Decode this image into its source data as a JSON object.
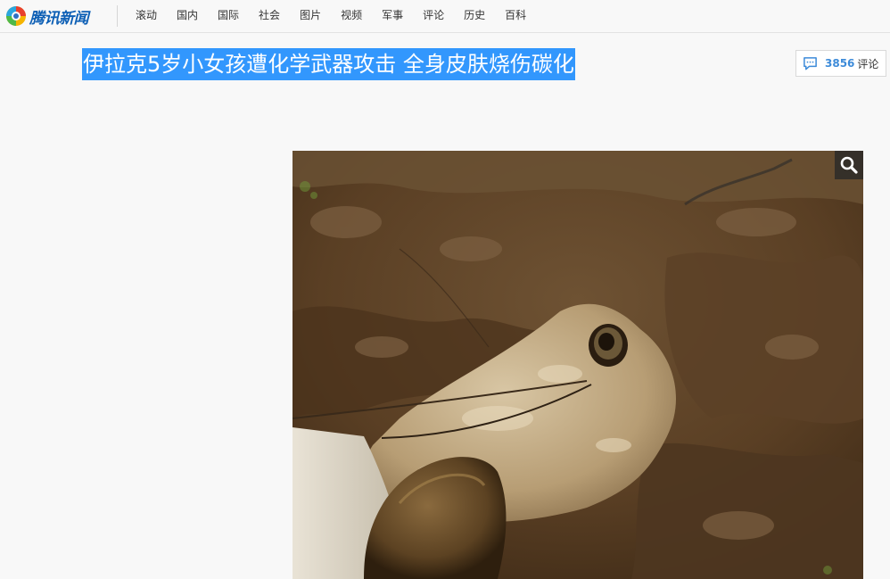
{
  "header": {
    "logo_text": "腾讯新闻",
    "nav": [
      "滚动",
      "国内",
      "国际",
      "社会",
      "图片",
      "视频",
      "军事",
      "评论",
      "历史",
      "百科"
    ]
  },
  "article": {
    "title": "伊拉克5岁小女孩遭化学武器攻击 全身皮肤烧伤碳化"
  },
  "comments": {
    "count": "3856",
    "label": "评论"
  },
  "colors": {
    "brand_blue": "#0d5fb5",
    "selection_blue": "#3297fd",
    "comment_blue": "#3d8bd9"
  },
  "icons": {
    "logo": "tencent-news-logo-icon",
    "comment": "comment-bubble-icon",
    "zoom": "magnifier-icon"
  }
}
